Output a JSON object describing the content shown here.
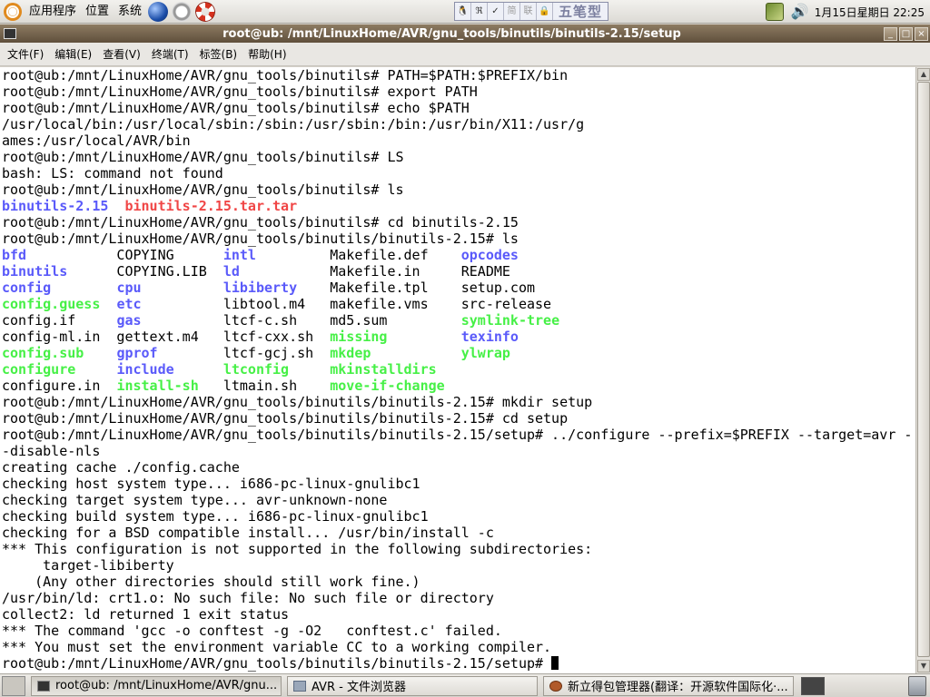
{
  "top_panel": {
    "menus": [
      "应用程序",
      "位置",
      "系统"
    ],
    "ime": {
      "cells": [
        "🐧",
        "ℜ",
        "✓",
        "简",
        "联",
        "🔒"
      ],
      "mode": "五笔型"
    },
    "clock": "1月15日星期日 22:25"
  },
  "window": {
    "title": "root@ub: /mnt/LinuxHome/AVR/gnu_tools/binutils/binutils-2.15/setup",
    "buttons": {
      "minimize": "_",
      "maximize": "□",
      "close": "×"
    }
  },
  "menubar": [
    "文件(F)",
    "编辑(E)",
    "查看(V)",
    "终端(T)",
    "标签(B)",
    "帮助(H)"
  ],
  "terminal": {
    "lines": [
      [
        {
          "t": "root@ub:/mnt/LinuxHome/AVR/gnu_tools/binutils# PATH=$PATH:$PREFIX/bin"
        }
      ],
      [
        {
          "t": "root@ub:/mnt/LinuxHome/AVR/gnu_tools/binutils# export PATH"
        }
      ],
      [
        {
          "t": "root@ub:/mnt/LinuxHome/AVR/gnu_tools/binutils# echo $PATH"
        }
      ],
      [
        {
          "t": "/usr/local/bin:/usr/local/sbin:/sbin:/usr/sbin:/bin:/usr/bin/X11:/usr/g"
        }
      ],
      [
        {
          "t": "ames:/usr/local/AVR/bin"
        }
      ],
      [
        {
          "t": "root@ub:/mnt/LinuxHome/AVR/gnu_tools/binutils# LS"
        }
      ],
      [
        {
          "t": "bash: LS: command not found"
        }
      ],
      [
        {
          "t": "root@ub:/mnt/LinuxHome/AVR/gnu_tools/binutils# ls"
        }
      ],
      [
        {
          "t": "binutils-2.15",
          "c": "blue"
        },
        {
          "t": "  "
        },
        {
          "t": "binutils-2.15.tar.tar",
          "c": "red"
        }
      ],
      [
        {
          "t": "root@ub:/mnt/LinuxHome/AVR/gnu_tools/binutils# cd binutils-2.15"
        }
      ],
      [
        {
          "t": "root@ub:/mnt/LinuxHome/AVR/gnu_tools/binutils/binutils-2.15# ls"
        }
      ],
      [
        {
          "t": "bfd",
          "c": "blue"
        },
        {
          "t": "           COPYING      "
        },
        {
          "t": "intl",
          "c": "blue"
        },
        {
          "t": "         Makefile.def    "
        },
        {
          "t": "opcodes",
          "c": "blue"
        }
      ],
      [
        {
          "t": "binutils",
          "c": "blue"
        },
        {
          "t": "      COPYING.LIB  "
        },
        {
          "t": "ld",
          "c": "blue"
        },
        {
          "t": "           Makefile.in     README"
        }
      ],
      [
        {
          "t": "config",
          "c": "blue"
        },
        {
          "t": "        "
        },
        {
          "t": "cpu",
          "c": "blue"
        },
        {
          "t": "          "
        },
        {
          "t": "libiberty",
          "c": "blue"
        },
        {
          "t": "    Makefile.tpl    setup.com"
        }
      ],
      [
        {
          "t": "config.guess",
          "c": "green"
        },
        {
          "t": "  "
        },
        {
          "t": "etc",
          "c": "blue"
        },
        {
          "t": "          libtool.m4   makefile.vms    src-release"
        }
      ],
      [
        {
          "t": "config.if     "
        },
        {
          "t": "gas",
          "c": "blue"
        },
        {
          "t": "          ltcf-c.sh    md5.sum         "
        },
        {
          "t": "symlink-tree",
          "c": "green"
        }
      ],
      [
        {
          "t": "config-ml.in  gettext.m4   ltcf-cxx.sh  "
        },
        {
          "t": "missing",
          "c": "green"
        },
        {
          "t": "         "
        },
        {
          "t": "texinfo",
          "c": "blue"
        }
      ],
      [
        {
          "t": "config.sub",
          "c": "green"
        },
        {
          "t": "    "
        },
        {
          "t": "gprof",
          "c": "blue"
        },
        {
          "t": "        ltcf-gcj.sh  "
        },
        {
          "t": "mkdep",
          "c": "green"
        },
        {
          "t": "           "
        },
        {
          "t": "ylwrap",
          "c": "green"
        }
      ],
      [
        {
          "t": "configure",
          "c": "green"
        },
        {
          "t": "     "
        },
        {
          "t": "include",
          "c": "blue"
        },
        {
          "t": "      "
        },
        {
          "t": "ltconfig",
          "c": "green"
        },
        {
          "t": "     "
        },
        {
          "t": "mkinstalldirs",
          "c": "green"
        }
      ],
      [
        {
          "t": "configure.in  "
        },
        {
          "t": "install-sh",
          "c": "green"
        },
        {
          "t": "   ltmain.sh    "
        },
        {
          "t": "move-if-change",
          "c": "green"
        }
      ],
      [
        {
          "t": "root@ub:/mnt/LinuxHome/AVR/gnu_tools/binutils/binutils-2.15# mkdir setup"
        }
      ],
      [
        {
          "t": "root@ub:/mnt/LinuxHome/AVR/gnu_tools/binutils/binutils-2.15# cd setup"
        }
      ],
      [
        {
          "t": "root@ub:/mnt/LinuxHome/AVR/gnu_tools/binutils/binutils-2.15/setup# ../configure --prefix=$PREFIX --target=avr -"
        }
      ],
      [
        {
          "t": "-disable-nls"
        }
      ],
      [
        {
          "t": "creating cache ./config.cache"
        }
      ],
      [
        {
          "t": "checking host system type... i686-pc-linux-gnulibc1"
        }
      ],
      [
        {
          "t": "checking target system type... avr-unknown-none"
        }
      ],
      [
        {
          "t": "checking build system type... i686-pc-linux-gnulibc1"
        }
      ],
      [
        {
          "t": "checking for a BSD compatible install... /usr/bin/install -c"
        }
      ],
      [
        {
          "t": "*** This configuration is not supported in the following subdirectories:"
        }
      ],
      [
        {
          "t": "     target-libiberty"
        }
      ],
      [
        {
          "t": "    (Any other directories should still work fine.)"
        }
      ],
      [
        {
          "t": "/usr/bin/ld: crt1.o: No such file: No such file or directory"
        }
      ],
      [
        {
          "t": "collect2: ld returned 1 exit status"
        }
      ],
      [
        {
          "t": "*** The command 'gcc -o conftest -g -O2   conftest.c' failed."
        }
      ],
      [
        {
          "t": "*** You must set the environment variable CC to a working compiler."
        }
      ],
      [
        {
          "t": "root@ub:/mnt/LinuxHome/AVR/gnu_tools/binutils/binutils-2.15/setup# "
        },
        {
          "cursor": true
        }
      ]
    ]
  },
  "taskbar": {
    "tasks": [
      {
        "label": "root@ub: /mnt/LinuxHome/AVR/gnu...",
        "icon": "terminal-icon",
        "active": true
      },
      {
        "label": "AVR - 文件浏览器",
        "icon": "folder-icon",
        "active": false
      },
      {
        "label": "新立得包管理器(翻译：开源软件国际化·...",
        "icon": "package-icon",
        "active": false
      }
    ]
  },
  "colors": {
    "dir": "#5a5afa",
    "exec": "#46f046",
    "archive": "#f04646",
    "titlebar": "#7a6850"
  }
}
